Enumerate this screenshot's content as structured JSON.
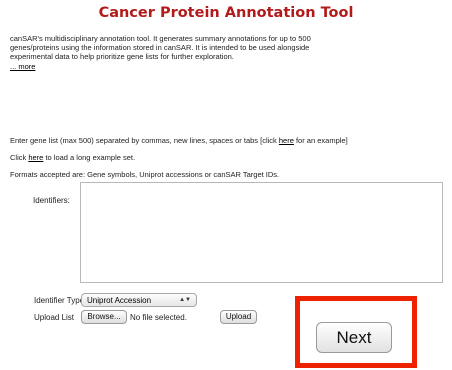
{
  "title": "Cancer Protein Annotation Tool",
  "intro": {
    "text": "canSAR's multidisciplinary annotation tool. It generates summary annotations for up to 500 genes/proteins using the information stored in canSAR. It is intended to be used alongside experimental data to help prioritize gene lists for further exploration.",
    "more_link": "... more"
  },
  "gene_list_instruction": {
    "before": "Enter gene list (max 500) separated by commas, new lines, spaces or tabs [click ",
    "link": "here",
    "after": " for an example]"
  },
  "long_example": {
    "before": "Click ",
    "link": "here",
    "after": " to load a long example set."
  },
  "formats_text": "Formats accepted are: Gene symbols, Uniprot accessions or canSAR Target IDs.",
  "identifiers": {
    "label": "Identifiers:",
    "value": ""
  },
  "identifier_type": {
    "label": "Identifier Type:",
    "selected": "Uniprot Accession"
  },
  "upload": {
    "label": "Upload List",
    "browse_label": "Browse...",
    "no_file_text": "No file selected.",
    "upload_label": "Upload"
  },
  "next_label": "Next",
  "colors": {
    "title": "#b31b1b",
    "highlight": "#ee2200"
  }
}
